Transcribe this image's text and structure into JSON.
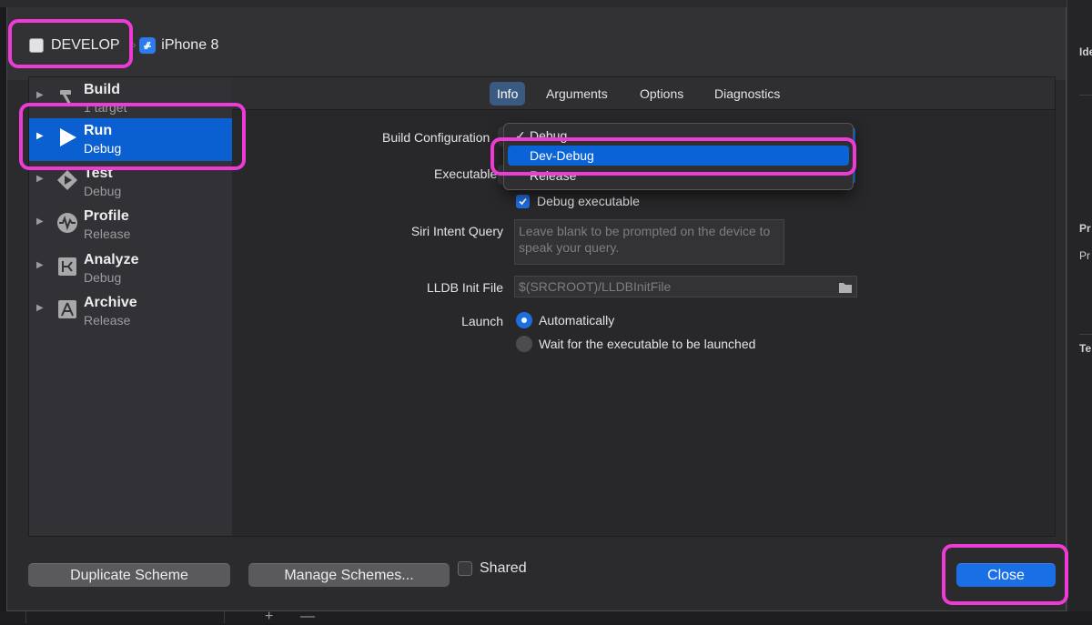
{
  "header": {
    "scheme_name": "DEVELOP",
    "device_name": "iPhone 8"
  },
  "sidebar": {
    "items": [
      {
        "title": "Build",
        "subtitle": "1 target",
        "icon": "hammer-icon"
      },
      {
        "title": "Run",
        "subtitle": "Debug",
        "icon": "play-icon",
        "selected": true
      },
      {
        "title": "Test",
        "subtitle": "Debug",
        "icon": "diamond-play-icon"
      },
      {
        "title": "Profile",
        "subtitle": "Release",
        "icon": "waveform-icon"
      },
      {
        "title": "Analyze",
        "subtitle": "Debug",
        "icon": "analyze-icon"
      },
      {
        "title": "Archive",
        "subtitle": "Release",
        "icon": "archive-icon"
      }
    ]
  },
  "tabs": [
    {
      "label": "Info",
      "active": true
    },
    {
      "label": "Arguments"
    },
    {
      "label": "Options"
    },
    {
      "label": "Diagnostics"
    }
  ],
  "form": {
    "build_config_label": "Build Configuration",
    "executable_label": "Executable",
    "debug_executable_label": "Debug executable",
    "debug_executable_checked": true,
    "siri_label": "Siri Intent Query",
    "siri_placeholder": "Leave blank to be prompted on the device to speak your query.",
    "lldb_label": "LLDB Init File",
    "lldb_placeholder": "$(SRCROOT)/LLDBInitFile",
    "launch_label": "Launch",
    "launch_options": [
      {
        "label": "Automatically",
        "selected": true
      },
      {
        "label": "Wait for the executable to be launched",
        "selected": false
      }
    ]
  },
  "build_config_menu": {
    "items": [
      {
        "label": "Debug",
        "checked": true
      },
      {
        "label": "Dev-Debug",
        "highlighted": true
      },
      {
        "label": "Release"
      }
    ]
  },
  "footer": {
    "duplicate_label": "Duplicate Scheme",
    "manage_label": "Manage Schemes...",
    "shared_label": "Shared",
    "shared_checked": false,
    "close_label": "Close"
  },
  "background_panel": {
    "labels": [
      "Ide",
      "Pr",
      "Pr",
      "Te"
    ],
    "bottom_plus": "+",
    "bottom_minus": "—"
  },
  "colors": {
    "accent": "#0a5fd1",
    "annotation": "#ee3bd6"
  }
}
